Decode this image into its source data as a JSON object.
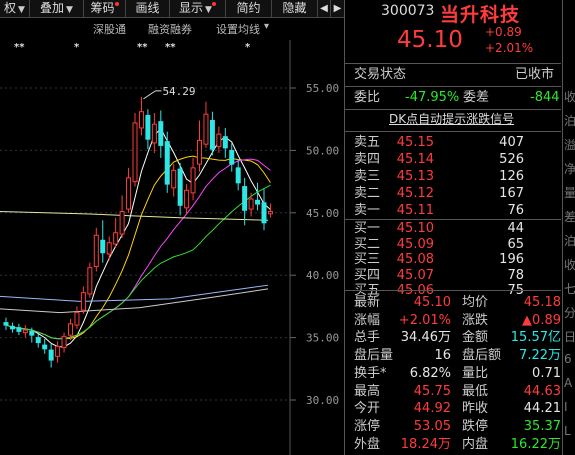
{
  "toolbar": {
    "items": [
      {
        "label": "权",
        "arrow": true,
        "dot": false
      },
      {
        "label": "叠加",
        "arrow": true,
        "dot": false
      },
      {
        "label": "筹码",
        "arrow": false,
        "dot": true
      },
      {
        "label": "画线",
        "arrow": false,
        "dot": false
      },
      {
        "label": "显示",
        "arrow": true,
        "dot": true
      },
      {
        "label": "简约",
        "arrow": false,
        "dot": false
      },
      {
        "label": "隐藏",
        "arrow": false,
        "dot": false
      }
    ],
    "nav_icons": [
      "chevron-left-icon",
      "chevron-right-icon"
    ]
  },
  "subbar": {
    "labels": [
      "深股通",
      "融资融券",
      "设置均线"
    ],
    "dropdown_arrow": "▾",
    "stars": [
      "**",
      "*",
      "**",
      "**",
      "*"
    ]
  },
  "chart": {
    "y_ticks": [
      "55.00",
      "50.00",
      "45.00",
      "40.00",
      "35.00",
      "30.00"
    ],
    "annotation": "54.29",
    "colors": {
      "up": "#ff3c3c",
      "down": "#2ee6e6",
      "ma5": "#ffffff",
      "ma10": "#ffd400",
      "ma20": "#ff44ff",
      "ma30": "#33dd33",
      "ma60": "#cccccc",
      "ma_long": "#9ab8ff"
    }
  },
  "stock": {
    "code": "300073",
    "name": "当升科技",
    "price": "45.10",
    "change": "+0.89",
    "change_pct": "+2.01%"
  },
  "status": {
    "label": "交易状态",
    "value": "已收市"
  },
  "weibi": {
    "label": "委比",
    "value": "-47.95%",
    "diff_label": "委差",
    "diff_value": "-844"
  },
  "signal_link": "DK点自动提示涨跌信号",
  "sells": [
    {
      "label": "卖五",
      "price": "45.15",
      "vol": "407"
    },
    {
      "label": "卖四",
      "price": "45.14",
      "vol": "526"
    },
    {
      "label": "卖三",
      "price": "45.13",
      "vol": "126"
    },
    {
      "label": "卖二",
      "price": "45.12",
      "vol": "167"
    },
    {
      "label": "卖一",
      "price": "45.11",
      "vol": "76"
    }
  ],
  "buys": [
    {
      "label": "买一",
      "price": "45.10",
      "vol": "44"
    },
    {
      "label": "买二",
      "price": "45.09",
      "vol": "65"
    },
    {
      "label": "买三",
      "price": "45.08",
      "vol": "196"
    },
    {
      "label": "买四",
      "price": "45.07",
      "vol": "78"
    },
    {
      "label": "买五",
      "price": "45.06",
      "vol": "75"
    }
  ],
  "stats": [
    {
      "l1": "最新",
      "v1": "45.10",
      "c1": "red",
      "l2": "均价",
      "v2": "45.18",
      "c2": "red"
    },
    {
      "l1": "涨幅",
      "v1": "+2.01%",
      "c1": "red",
      "l2": "涨跌",
      "v2": "▲0.89",
      "c2": "red"
    },
    {
      "l1": "总手",
      "v1": "34.46万",
      "c1": "wht",
      "l2": "金额",
      "v2": "15.57亿",
      "c2": "cyn"
    },
    {
      "l1": "盘后量",
      "v1": "16",
      "c1": "wht",
      "l2": "盘后额",
      "v2": "7.22万",
      "c2": "cyn"
    },
    {
      "l1": "换手*",
      "v1": "6.82%",
      "c1": "wht",
      "l2": "量比",
      "v2": "0.71",
      "c2": "wht"
    },
    {
      "l1": "最高",
      "v1": "45.75",
      "c1": "red",
      "l2": "最低",
      "v2": "44.63",
      "c2": "red"
    },
    {
      "l1": "今开",
      "v1": "44.92",
      "c1": "red",
      "l2": "昨收",
      "v2": "44.21",
      "c2": "wht"
    },
    {
      "l1": "涨停",
      "v1": "53.05",
      "c1": "red",
      "l2": "跌停",
      "v2": "35.37",
      "c2": "grn"
    },
    {
      "l1": "外盘",
      "v1": "18.24万",
      "c1": "red",
      "l2": "内盘",
      "v2": "16.22万",
      "c2": "grn"
    }
  ],
  "edge_chars": [
    "收",
    "泊",
    "溢",
    "净",
    "量",
    "差",
    "泊",
    "收",
    "七",
    "分",
    "日",
    "6",
    "A",
    "I",
    "L"
  ]
}
